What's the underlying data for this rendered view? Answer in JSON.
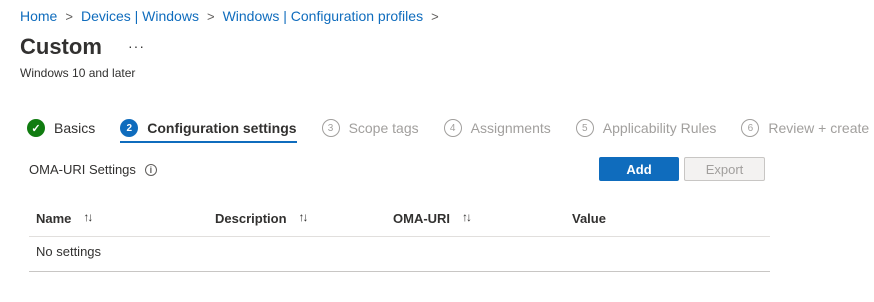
{
  "breadcrumb": [
    {
      "label": "Home"
    },
    {
      "label": "Devices | Windows"
    },
    {
      "label": "Windows | Configuration profiles"
    }
  ],
  "breadcrumb_separator": ">",
  "page": {
    "title": "Custom",
    "more_label": "···",
    "subtitle": "Windows 10 and later"
  },
  "steps": [
    {
      "label": "Basics",
      "number": "✓",
      "state": "done"
    },
    {
      "label": "Configuration settings",
      "number": "2",
      "state": "active"
    },
    {
      "label": "Scope tags",
      "number": "3",
      "state": "pending"
    },
    {
      "label": "Assignments",
      "number": "4",
      "state": "pending"
    },
    {
      "label": "Applicability Rules",
      "number": "5",
      "state": "pending"
    },
    {
      "label": "Review + create",
      "number": "6",
      "state": "pending"
    }
  ],
  "oma": {
    "label": "OMA-URI Settings",
    "info_icon": "i"
  },
  "buttons": {
    "add": "Add",
    "export": "Export"
  },
  "table": {
    "columns": [
      {
        "label": "Name",
        "sort_icon": "↑↓"
      },
      {
        "label": "Description",
        "sort_icon": "↑↓"
      },
      {
        "label": "OMA-URI",
        "sort_icon": "↑↓"
      },
      {
        "label": "Value",
        "sort_icon": ""
      }
    ],
    "empty_text": "No settings"
  },
  "colors": {
    "accent": "#0f6cbd",
    "success": "#107c10",
    "disabled_text": "#a19f9d"
  }
}
